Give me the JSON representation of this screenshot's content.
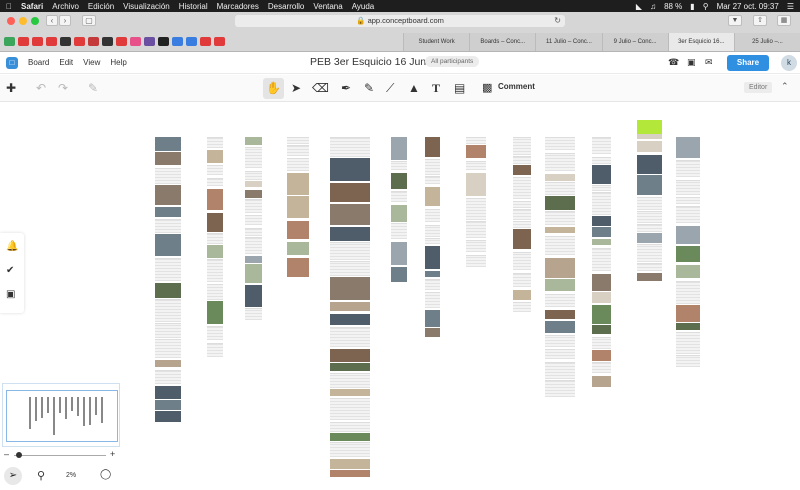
{
  "menubar": {
    "items": [
      "Safari",
      "Archivo",
      "Edición",
      "Visualización",
      "Historial",
      "Marcadores",
      "Desarrollo",
      "Ventana",
      "Ayuda"
    ],
    "battery": "88 %",
    "datetime": "Mar 27 oct.  09:37"
  },
  "browser": {
    "url": "app.conceptboard.com",
    "tabs": [
      "Student Work",
      "Boards – Conc...",
      "11 Julio – Conc...",
      "9 Julio – Conc...",
      "3er Esquicio 16...",
      "25 Julio –..."
    ],
    "active_tab_index": 4,
    "favicon_colors": [
      "#3ba55c",
      "#e03a3a",
      "#e03a3a",
      "#e03a3a",
      "#333333",
      "#e03a3a",
      "#c43a3a",
      "#333333",
      "#e03a3a",
      "#e8508a",
      "#6b4fa0",
      "#222222",
      "#3a7de0",
      "#3a7de0",
      "#e03a3a",
      "#e03a3a"
    ]
  },
  "header": {
    "menu": [
      "Board",
      "Edit",
      "View",
      "Help"
    ],
    "title": "PEB 3er Esquicio 16 Junio",
    "participants": "All participants",
    "share_label": "Share",
    "avatar_initial": "k"
  },
  "toolbar": {
    "comment_label": "Comment",
    "editor_label": "Editor"
  },
  "zoom": {
    "percent": "2%"
  },
  "colors": {
    "accent": "#2f8fe0",
    "menubar": "#1e1e1e"
  }
}
